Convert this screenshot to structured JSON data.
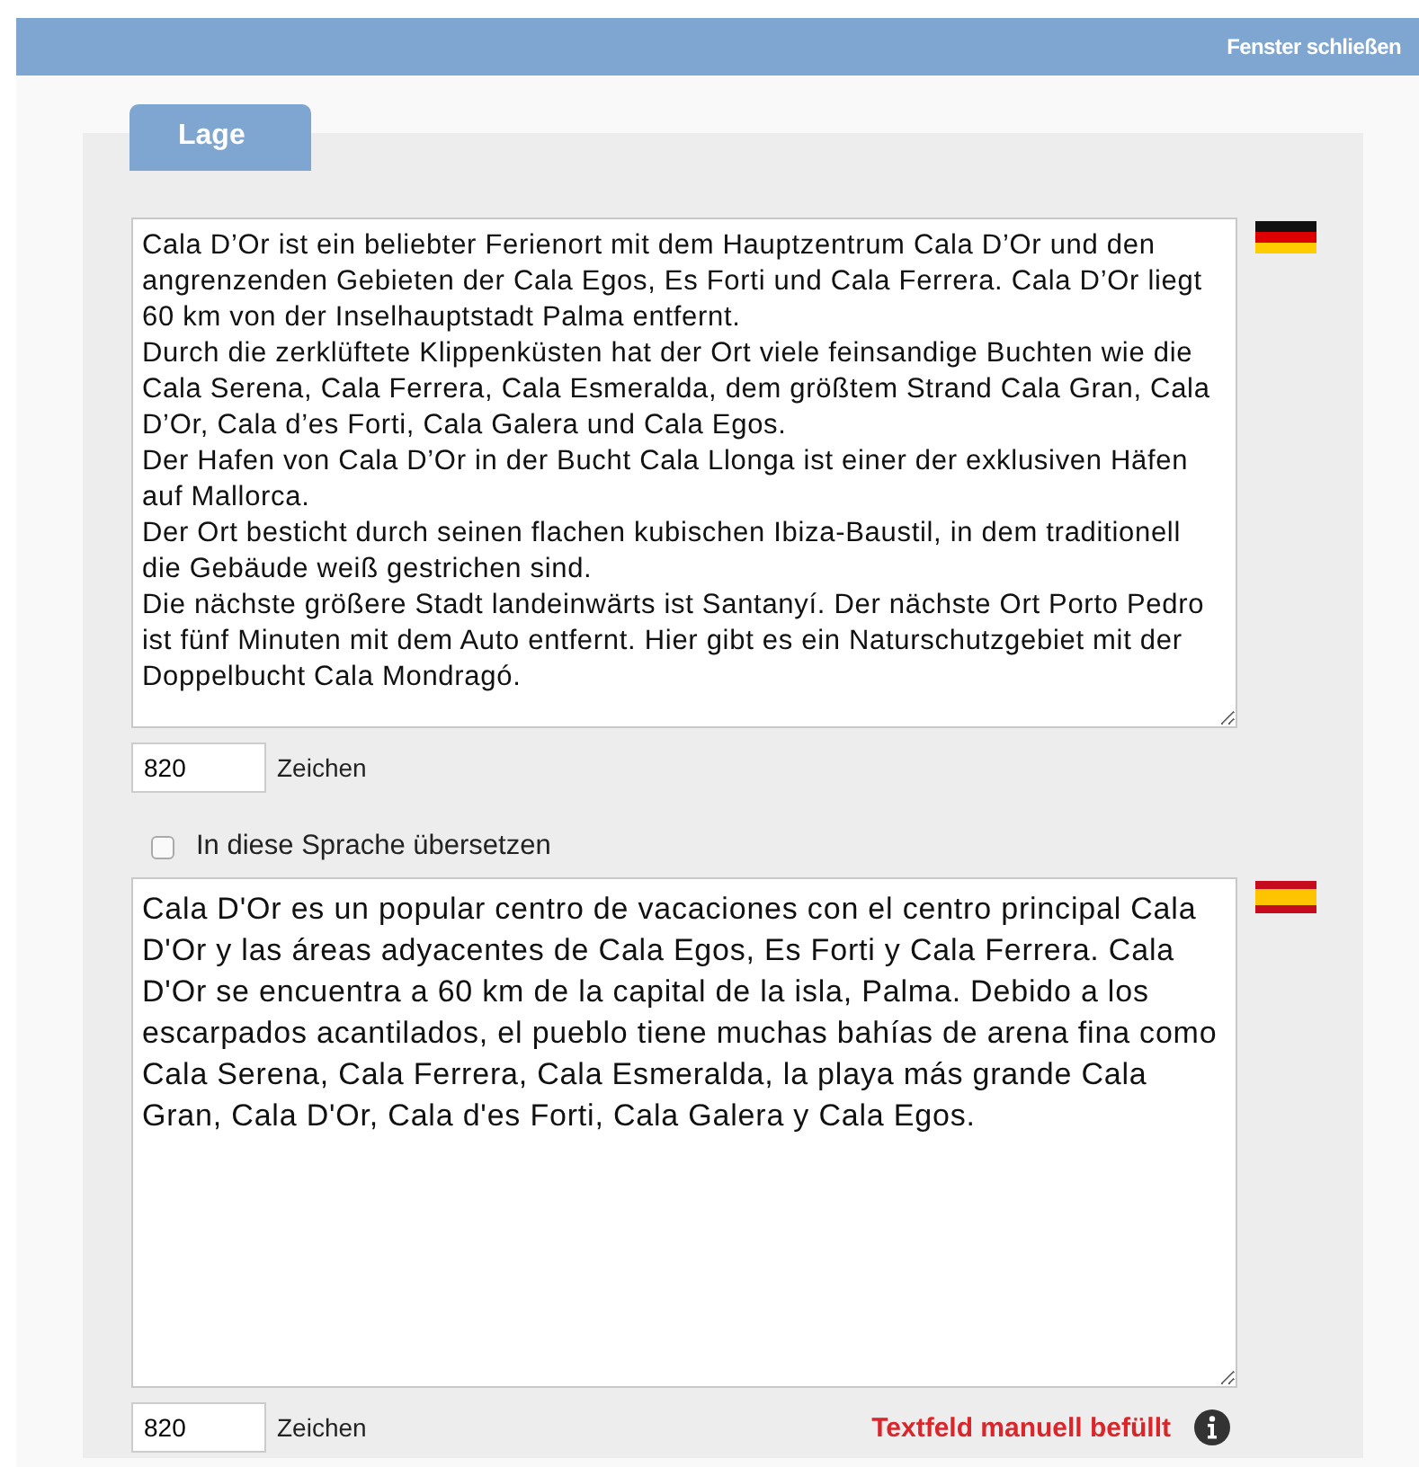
{
  "header": {
    "close_link": "Fenster schließen"
  },
  "tabs": [
    {
      "label": "Lage",
      "selected": true
    }
  ],
  "blocks": [
    {
      "kind": "german",
      "text": "Cala D’Or ist ein beliebter Ferienort mit dem Hauptzentrum Cala D’Or und den angrenzenden Gebieten der Cala Egos, Es Forti und Cala Ferrera. Cala D’Or liegt 60 km von der Inselhauptstadt Palma entfernt.\nDurch die zerklüftete Klippenküsten hat der Ort viele feinsandige Buchten wie die Cala Serena, Cala Ferrera, Cala Esmeralda, dem größtem Strand Cala Gran, Cala D’Or, Cala d’es Forti, Cala Galera und Cala Egos.\nDer Hafen von Cala D’Or in der Bucht Cala Llonga ist einer der exklusiven Häfen auf Mallorca.\nDer Ort besticht durch seinen flachen kubischen Ibiza-Baustil, in dem traditionell die Gebäude weiß gestrichen sind.\nDie nächste größere Stadt landeinwärts ist Santanyí. Der nächste Ort Porto Pedro ist fünf Minuten mit dem Auto entfernt. Hier gibt es ein Naturschutzgebiet mit der Doppelbucht Cala Mondragó.",
      "char_count": "820",
      "char_label": "Zeichen"
    },
    {
      "translate": {
        "label": "In diese Sprache übersetzen",
        "checked": false
      },
      "kind": "spanish",
      "text": "Cala D'Or es un popular centro de vacaciones con el centro principal Cala D'Or y las áreas adyacentes de Cala Egos, Es Forti y Cala Ferrera. Cala D'Or se encuentra a 60 km de la capital de la isla, Palma. Debido a los escarpados acantilados, el pueblo tiene muchas bahías de arena fina como Cala Serena, Cala Ferrera, Cala Esmeralda, la playa más grande Cala Gran, Cala D'Or, Cala d'es Forti, Cala Galera y Cala Egos.",
      "char_count": "820",
      "char_label": "Zeichen",
      "status": "Textfeld manuell befüllt"
    }
  ]
}
